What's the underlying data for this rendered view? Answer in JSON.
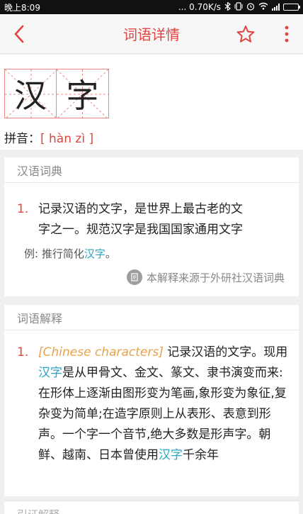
{
  "status_bar": {
    "time": "晚上8:09",
    "network_speed": "... 0.70K/s"
  },
  "header": {
    "title": "词语详情"
  },
  "word": {
    "chars": [
      "汉",
      "字"
    ],
    "pinyin_label": "拼音：",
    "pinyin": "[ hàn zì ]"
  },
  "dictionary": {
    "section_title": "汉语词典",
    "definitions": [
      {
        "num": "1.",
        "text_line1": "记录汉语的文字，是世界上最古老的文",
        "text_line2": "字之一。规范汉字是我国国家通用文字"
      }
    ],
    "example_prefix": "例: 推行简化",
    "example_highlight": "汉字",
    "example_suffix": "。",
    "source": "本解释来源于外研社汉语词典"
  },
  "explanation": {
    "section_title": "词语解释",
    "num": "1.",
    "english": "[Chinese characters]",
    "part1": " 记录汉语的文字。现用",
    "hl1": "汉字",
    "part2": "是从甲骨文、金文、篆文、隶书演变而来:在形体上逐渐由图形变为笔画,象形变为象征,复杂变为简单;在造字原则上从表形、表意到形声。一个字一个音节,绝大多数是形声字。朝鲜、越南、日本曾使用",
    "hl2": "汉字",
    "part3": "千余年"
  },
  "next_section": {
    "title": "引证解释"
  },
  "colors": {
    "accent": "#e0443e",
    "link": "#2aa6c4",
    "english": "#e8a24b"
  }
}
